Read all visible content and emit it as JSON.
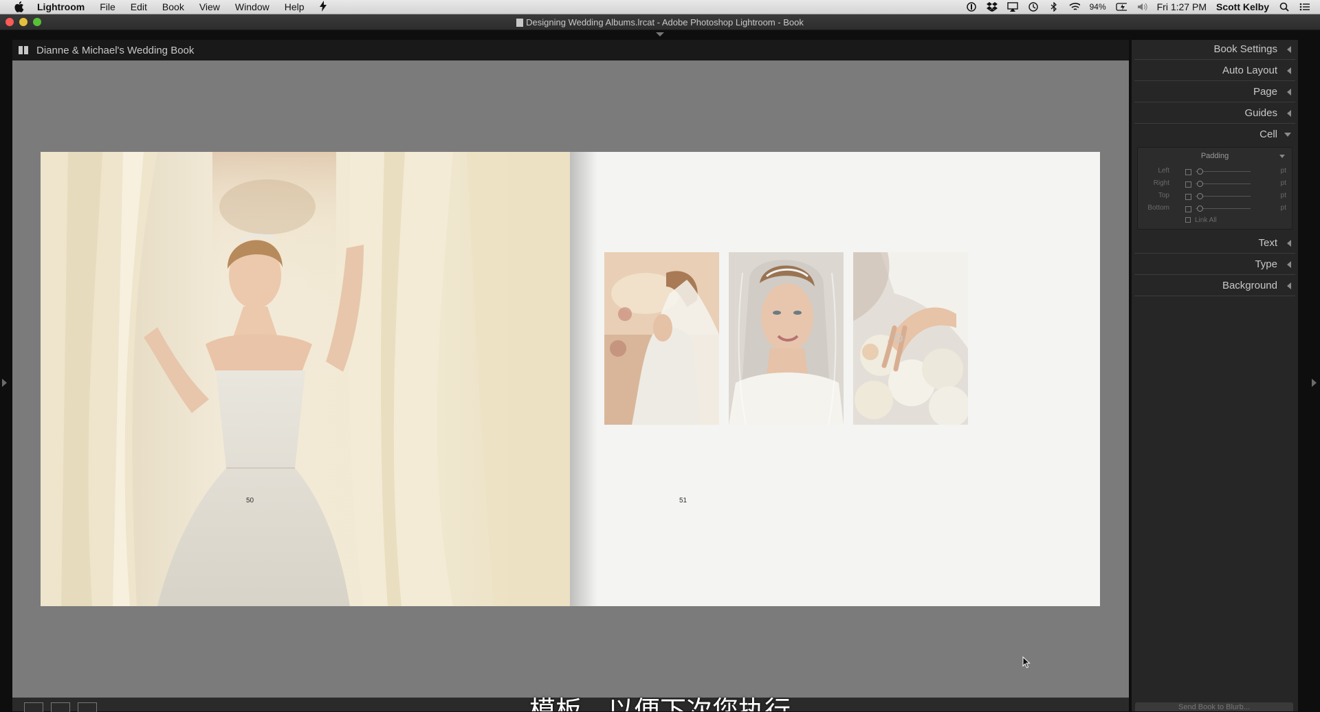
{
  "menubar": {
    "app": "Lightroom",
    "items": [
      "File",
      "Edit",
      "Book",
      "View",
      "Window",
      "Help"
    ],
    "battery": "94%",
    "clock": "Fri 1:27 PM",
    "user": "Scott Kelby"
  },
  "window": {
    "title": "Designing Wedding Albums.lrcat - Adobe Photoshop Lightroom - Book"
  },
  "book": {
    "title": "Dianne & Michael's Wedding Book",
    "left_page_number": "50",
    "right_page_number": "51"
  },
  "panel": {
    "book_settings": "Book Settings",
    "auto_layout": "Auto Layout",
    "page": "Page",
    "guides": "Guides",
    "cell": "Cell",
    "padding": {
      "title": "Padding",
      "left": "Left",
      "right": "Right",
      "top": "Top",
      "bottom": "Bottom",
      "unit": "pt",
      "link_all": "Link All"
    },
    "text": "Text",
    "type": "Type",
    "background": "Background",
    "send_button": "Send Book to Blurb..."
  },
  "subtitle": "模板，以便下次您执行",
  "colors": {
    "workspace": "#7b7b7b",
    "panel": "#262626",
    "page_bg": "#f4f4f2"
  }
}
